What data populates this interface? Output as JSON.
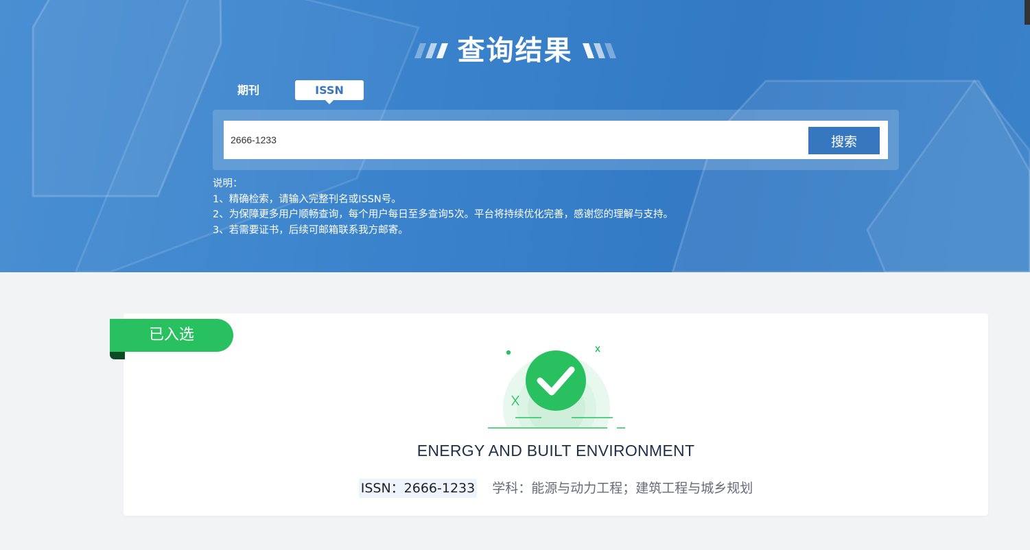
{
  "header": {
    "title": "查询结果",
    "tabs": [
      {
        "label": "期刊",
        "active": false
      },
      {
        "label": "ISSN",
        "active": true
      }
    ]
  },
  "search": {
    "value": "2666-1233",
    "button_label": "搜索"
  },
  "notes": {
    "heading": "说明：",
    "items": [
      "1、精确检索，请输入完整刊名或ISSN号。",
      "2、为保障更多用户顺畅查询，每个用户每日至多查询5次。平台将持续优化完善，感谢您的理解与支持。",
      "3、若需要证书，后续可邮箱联系我方邮寄。"
    ]
  },
  "result": {
    "status_badge": "已入选",
    "journal_name": "ENERGY AND BUILT ENVIRONMENT",
    "issn_text": "ISSN：2666-1233",
    "subject_text": "学科：能源与动力工程；建筑工程与城乡规划"
  },
  "colors": {
    "header_blue": "#3a83cc",
    "button_blue": "#3677bf",
    "success_green": "#29c160",
    "ribbon_fold": "#0c4a25",
    "page_background": "#f2f3f5"
  }
}
